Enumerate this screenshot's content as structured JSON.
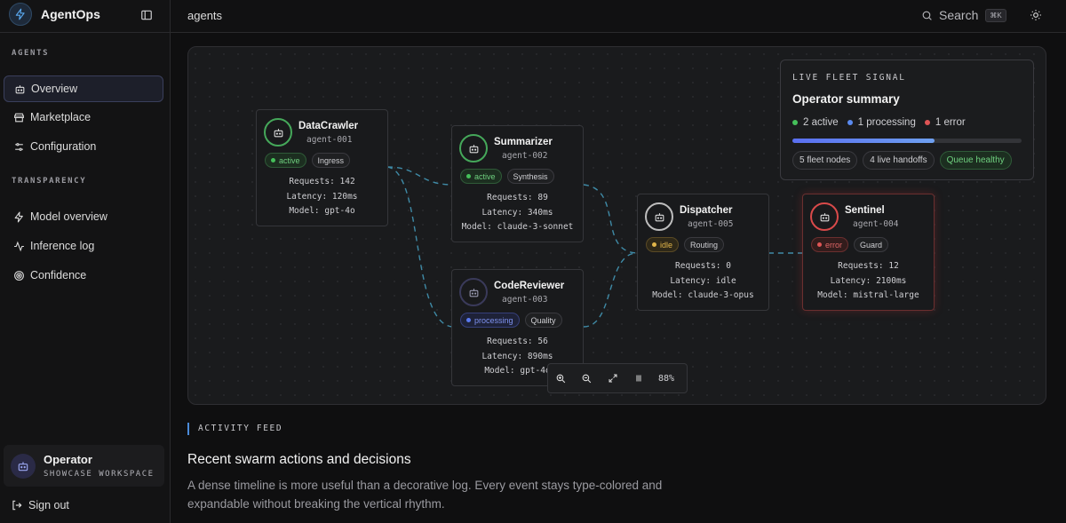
{
  "brand": {
    "name": "AgentOps"
  },
  "header": {
    "breadcrumb": "agents",
    "search_label": "Search",
    "search_shortcut": "⌘K"
  },
  "sidebar": {
    "sections": [
      {
        "label": "AGENTS",
        "items": [
          {
            "label": "Overview",
            "icon": "bot-icon",
            "active": true
          },
          {
            "label": "Marketplace",
            "icon": "store-icon"
          },
          {
            "label": "Configuration",
            "icon": "sliders-icon"
          }
        ]
      },
      {
        "label": "TRANSPARENCY",
        "items": [
          {
            "label": "Model overview",
            "icon": "zap-icon"
          },
          {
            "label": "Inference log",
            "icon": "activity-icon"
          },
          {
            "label": "Confidence",
            "icon": "target-icon"
          }
        ]
      }
    ],
    "operator": {
      "name": "Operator",
      "subtitle": "SHOWCASE WORKSPACE"
    },
    "signout_label": "Sign out"
  },
  "nodes": [
    {
      "name": "DataCrawler",
      "id": "agent-001",
      "status": "active",
      "role": "Ingress",
      "requests": "Requests: 142",
      "latency": "Latency: 120ms",
      "model": "Model: gpt-4o"
    },
    {
      "name": "Summarizer",
      "id": "agent-002",
      "status": "active",
      "role": "Synthesis",
      "requests": "Requests: 89",
      "latency": "Latency: 340ms",
      "model": "Model: claude-3-sonnet"
    },
    {
      "name": "CodeReviewer",
      "id": "agent-003",
      "status": "processing",
      "role": "Quality",
      "requests": "Requests: 56",
      "latency": "Latency: 890ms",
      "model": "Model: gpt-4o"
    },
    {
      "name": "Dispatcher",
      "id": "agent-005",
      "status": "idle",
      "role": "Routing",
      "requests": "Requests: 0",
      "latency": "Latency: idle",
      "model": "Model: claude-3-opus"
    },
    {
      "name": "Sentinel",
      "id": "agent-004",
      "status": "error",
      "role": "Guard",
      "requests": "Requests: 12",
      "latency": "Latency: 2100ms",
      "model": "Model: mistral-large"
    }
  ],
  "summary": {
    "label": "LIVE FLEET SIGNAL",
    "title": "Operator summary",
    "active": "2 active",
    "processing": "1 processing",
    "error": "1 error",
    "progress": 0.62,
    "chips": [
      "5 fleet nodes",
      "4 live handoffs",
      "Queue healthy"
    ]
  },
  "zoom": {
    "level": "88%"
  },
  "activity": {
    "label": "ACTIVITY FEED",
    "title": "Recent swarm actions and decisions",
    "description": "A dense timeline is more useful than a decorative log. Every event stays type-colored and expandable without breaking the vertical rhythm."
  },
  "colors": {
    "active": "#45a85a",
    "processing": "#5a7af0",
    "error": "#d94a4a",
    "idle": "#e0b54a",
    "edge": "#3f8aa6"
  }
}
